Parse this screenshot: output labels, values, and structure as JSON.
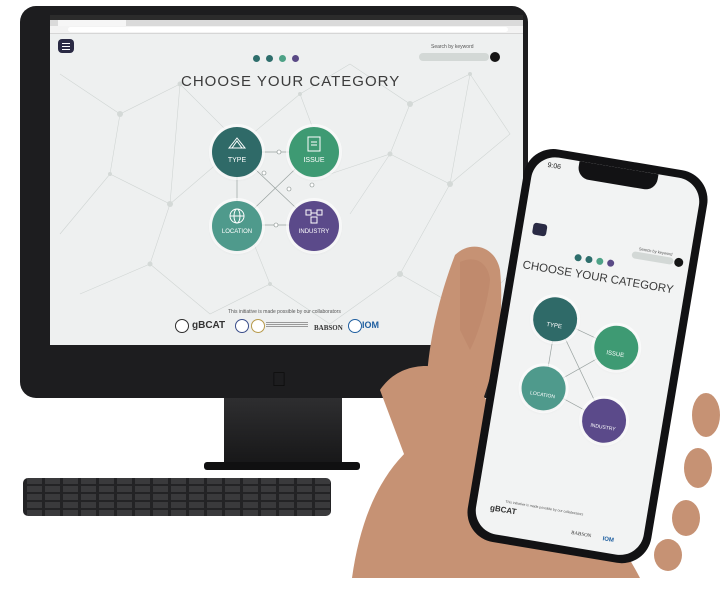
{
  "imac_page": {
    "title": "CHOOSE YOUR CATEGORY",
    "search_label": "Search by keyword",
    "footer_text": "This initiative is made possible by our collaborators",
    "progress_dots": [
      "#2e6e6c",
      "#2e6e6c",
      "#4ea287",
      "#5a4a86"
    ],
    "categories": [
      {
        "key": "type",
        "label": "TYPE",
        "color": "#2f6a68",
        "icon": "document-stack-icon"
      },
      {
        "key": "issue",
        "label": "ISSUE",
        "color": "#3e9a73",
        "icon": "clipboard-icon"
      },
      {
        "key": "location",
        "label": "LOCATION",
        "color": "#4f9a8c",
        "icon": "globe-icon"
      },
      {
        "key": "industry",
        "label": "INDUSTRY",
        "color": "#5b4a8a",
        "icon": "factory-network-icon"
      }
    ],
    "logos": [
      "gBCAT",
      "BABSON",
      "IOM"
    ]
  },
  "phone_page": {
    "status_time": "9:06",
    "title": "CHOOSE YOUR CATEGORY",
    "search_label": "Search by keyword",
    "footer_text": "This initiative is made possible by our collaborators",
    "categories": [
      {
        "label": "TYPE"
      },
      {
        "label": "ISSUE"
      },
      {
        "label": "LOCATION"
      },
      {
        "label": "INDUSTRY"
      }
    ],
    "logos": [
      "gBCAT",
      "BABSON",
      "IOM"
    ]
  },
  "colors": {
    "imac_body": "#1d1d1f",
    "screen_bg": "#eef0f0",
    "skin": "#c9967a"
  }
}
